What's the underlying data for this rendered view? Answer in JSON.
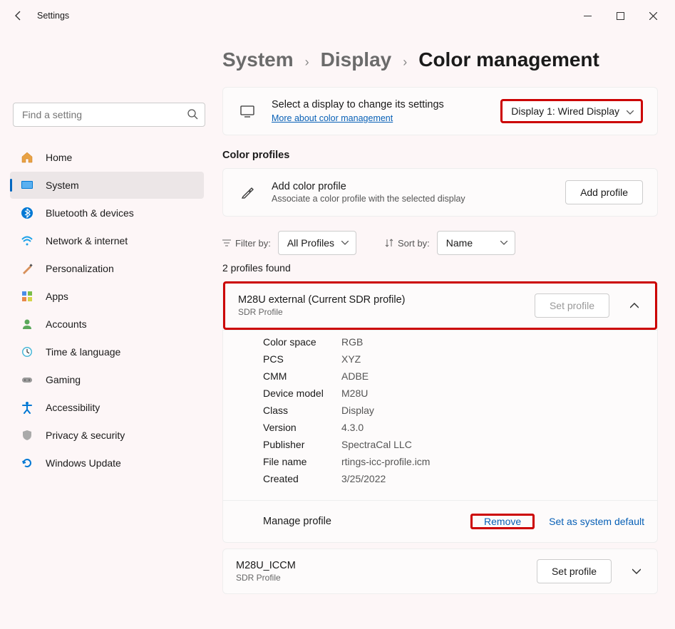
{
  "window": {
    "title": "Settings"
  },
  "search": {
    "placeholder": "Find a setting"
  },
  "nav": {
    "items": [
      {
        "label": "Home"
      },
      {
        "label": "System"
      },
      {
        "label": "Bluetooth & devices"
      },
      {
        "label": "Network & internet"
      },
      {
        "label": "Personalization"
      },
      {
        "label": "Apps"
      },
      {
        "label": "Accounts"
      },
      {
        "label": "Time & language"
      },
      {
        "label": "Gaming"
      },
      {
        "label": "Accessibility"
      },
      {
        "label": "Privacy & security"
      },
      {
        "label": "Windows Update"
      }
    ]
  },
  "breadcrumb": {
    "a": "System",
    "b": "Display",
    "c": "Color management"
  },
  "display_select": {
    "title": "Select a display to change its settings",
    "link": "More about color management",
    "value": "Display 1: Wired Display"
  },
  "profiles_header": "Color profiles",
  "add_profile": {
    "title": "Add color profile",
    "sub": "Associate a color profile with the selected display",
    "button": "Add profile"
  },
  "filter": {
    "label": "Filter by:",
    "value": "All Profiles"
  },
  "sort": {
    "label": "Sort by:",
    "value": "Name"
  },
  "count": "2 profiles found",
  "profile1": {
    "name": "M28U external (Current SDR profile)",
    "sub": "SDR Profile",
    "set_btn": "Set profile",
    "details": [
      {
        "k": "Color space",
        "v": "RGB"
      },
      {
        "k": "PCS",
        "v": "XYZ"
      },
      {
        "k": "CMM",
        "v": "ADBE"
      },
      {
        "k": "Device model",
        "v": "M28U"
      },
      {
        "k": "Class",
        "v": "Display"
      },
      {
        "k": "Version",
        "v": "4.3.0"
      },
      {
        "k": "Publisher",
        "v": "SpectraCal LLC"
      },
      {
        "k": "File name",
        "v": "rtings-icc-profile.icm"
      },
      {
        "k": "Created",
        "v": "3/25/2022"
      }
    ],
    "manage_label": "Manage profile",
    "remove": "Remove",
    "sysdef": "Set as system default"
  },
  "profile2": {
    "name": "M28U_ICCM",
    "sub": "SDR Profile",
    "set_btn": "Set profile"
  }
}
